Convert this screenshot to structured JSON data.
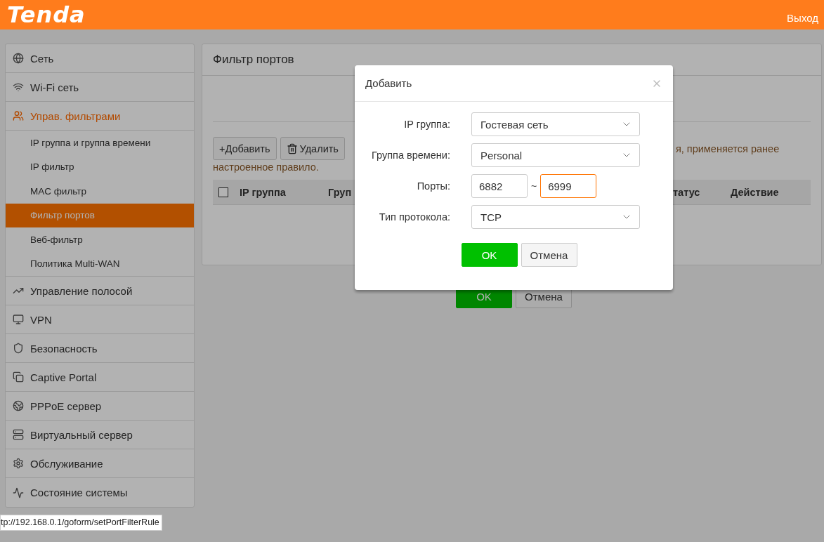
{
  "header": {
    "logo": "Tenda",
    "logout": "Выход"
  },
  "sidebar": {
    "items": [
      {
        "label": "Сеть",
        "active": false
      },
      {
        "label": "Wi-Fi сеть",
        "active": false
      },
      {
        "label": "Управ. фильтрами",
        "active": true,
        "children": [
          {
            "label": "IP группа и группа времени",
            "selected": false
          },
          {
            "label": "IP фильтр",
            "selected": false
          },
          {
            "label": "MAC фильтр",
            "selected": false
          },
          {
            "label": "Фильтр портов",
            "selected": true
          },
          {
            "label": "Веб-фильтр",
            "selected": false
          },
          {
            "label": "Политика Multi-WAN",
            "selected": false
          }
        ]
      },
      {
        "label": "Управление полосой",
        "active": false
      },
      {
        "label": "VPN",
        "active": false
      },
      {
        "label": "Безопасность",
        "active": false
      },
      {
        "label": "Captive Portal",
        "active": false
      },
      {
        "label": "PPPoE сервер",
        "active": false
      },
      {
        "label": "Виртуальный сервер",
        "active": false
      },
      {
        "label": "Обслуживание",
        "active": false
      },
      {
        "label": "Состояние системы",
        "active": false
      }
    ]
  },
  "main": {
    "title": "Фильтр портов",
    "toolbar": [
      "+Добавить",
      "Удалить"
    ],
    "notice_line_1": "я, применяется ранее",
    "notice_line_2": "настроенное правило.",
    "table": {
      "select_all": {
        "checked": false
      },
      "columns": [
        "IP группа",
        "Груп",
        "татус",
        "Действие"
      ]
    },
    "buttons": [
      "OK",
      "Отмена"
    ]
  },
  "dialog": {
    "title": "Добавить",
    "fields": [
      {
        "kind": "select",
        "label": "IP группа:",
        "value": "Гостевая сеть"
      },
      {
        "kind": "select",
        "label": "Группа времени:",
        "value": "Personal"
      },
      {
        "kind": "range",
        "label": "Порты:",
        "separator": "~",
        "inputs": [
          {
            "value": "6882",
            "focused": false
          },
          {
            "value": "6999",
            "focused": true
          }
        ]
      },
      {
        "kind": "select",
        "label": "Тип протокола:",
        "value": "TCP"
      }
    ],
    "buttons": [
      {
        "label": "OK",
        "kind": "primary"
      },
      {
        "label": "Отмена",
        "kind": "secondary"
      }
    ]
  },
  "status_url": "tp://192.168.0.1/goform/setPortFilterRule"
}
